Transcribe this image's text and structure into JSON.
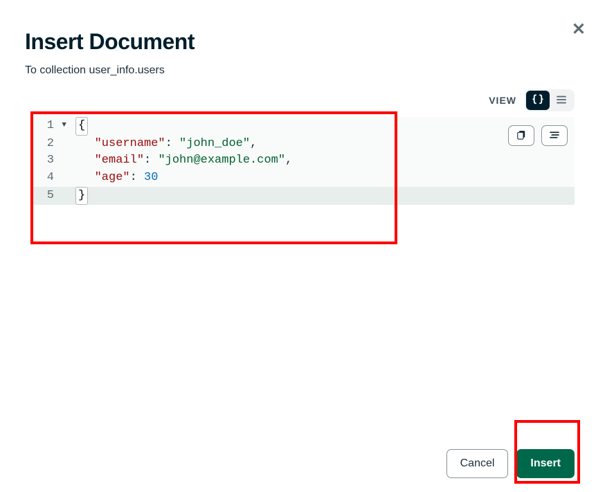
{
  "dialog": {
    "title": "Insert Document",
    "subtitle": "To collection user_info.users"
  },
  "view": {
    "label": "VIEW"
  },
  "editor": {
    "lines": [
      {
        "num": "1",
        "fold": true,
        "content_html": "brace_open"
      },
      {
        "num": "2",
        "fold": false,
        "key": "\"username\"",
        "sep": ": ",
        "val_str": "\"john_doe\"",
        "trail": ","
      },
      {
        "num": "3",
        "fold": false,
        "key": "\"email\"",
        "sep": ": ",
        "val_str": "\"john@example.com\"",
        "trail": ","
      },
      {
        "num": "4",
        "fold": false,
        "key": "\"age\"",
        "sep": ": ",
        "val_num": "30",
        "trail": ""
      },
      {
        "num": "5",
        "fold": false,
        "content_html": "brace_close",
        "highlight": true
      }
    ]
  },
  "footer": {
    "cancel": "Cancel",
    "insert": "Insert"
  }
}
